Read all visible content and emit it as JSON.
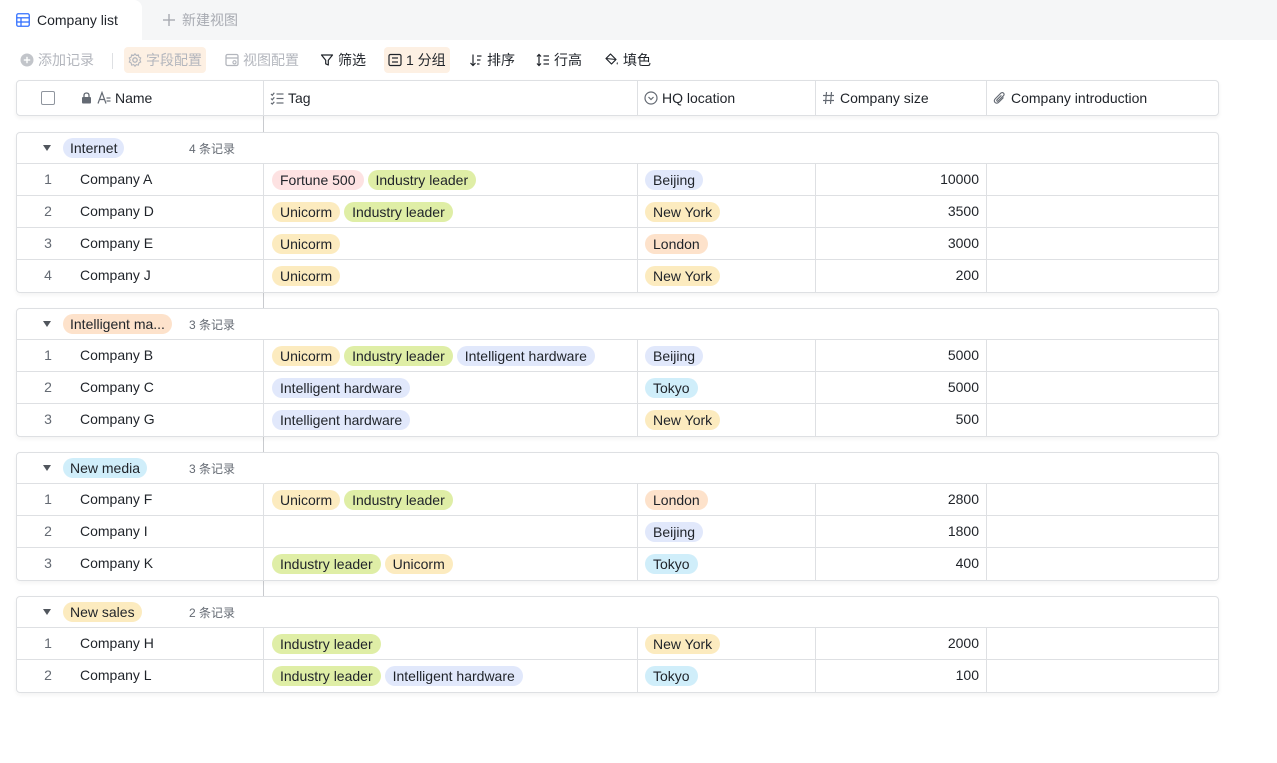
{
  "tabs": {
    "active_label": "Company list",
    "new_label": "新建视图"
  },
  "toolbar": {
    "add_record": "添加记录",
    "field_config": "字段配置",
    "view_config": "视图配置",
    "filter": "筛选",
    "group": "1 分组",
    "sort": "排序",
    "row_height": "行高",
    "fill_color": "填色"
  },
  "columns": {
    "name": "Name",
    "tag": "Tag",
    "hq": "HQ location",
    "size": "Company size",
    "intro": "Company introduction"
  },
  "colors": {
    "Fortune 500": "#fde2e2",
    "Industry leader": "#dfeea6",
    "Unicorm": "#fcebbf",
    "Intelligent hardware": "#e1e8fb",
    "Beijing": "#e1e8fb",
    "New York": "#fcebbf",
    "London": "#fde2cb",
    "Tokyo": "#d0eefa",
    "group_internet": "#e1e8fb",
    "group_intelligent": "#fde2cb",
    "group_newmedia": "#d0eefa",
    "group_newsales": "#fcebbf"
  },
  "groups": [
    {
      "name": "Internet",
      "count": "4 条记录",
      "rows": [
        {
          "num": "1",
          "name": "Company A",
          "tags": [
            "Fortune 500",
            "Industry leader"
          ],
          "hq": "Beijing",
          "size": "10000"
        },
        {
          "num": "2",
          "name": "Company D",
          "tags": [
            "Unicorm",
            "Industry leader"
          ],
          "hq": "New York",
          "size": "3500"
        },
        {
          "num": "3",
          "name": "Company E",
          "tags": [
            "Unicorm"
          ],
          "hq": "London",
          "size": "3000"
        },
        {
          "num": "4",
          "name": "Company J",
          "tags": [
            "Unicorm"
          ],
          "hq": "New York",
          "size": "200"
        }
      ]
    },
    {
      "name": "Intelligent ma...",
      "count": "3 条记录",
      "rows": [
        {
          "num": "1",
          "name": "Company B",
          "tags": [
            "Unicorm",
            "Industry leader",
            "Intelligent hardware"
          ],
          "hq": "Beijing",
          "size": "5000"
        },
        {
          "num": "2",
          "name": "Company C",
          "tags": [
            "Intelligent hardware"
          ],
          "hq": "Tokyo",
          "size": "5000"
        },
        {
          "num": "3",
          "name": "Company G",
          "tags": [
            "Intelligent hardware"
          ],
          "hq": "New York",
          "size": "500"
        }
      ]
    },
    {
      "name": "New media",
      "count": "3 条记录",
      "rows": [
        {
          "num": "1",
          "name": "Company F",
          "tags": [
            "Unicorm",
            "Industry leader"
          ],
          "hq": "London",
          "size": "2800"
        },
        {
          "num": "2",
          "name": "Company I",
          "tags": [],
          "hq": "Beijing",
          "size": "1800"
        },
        {
          "num": "3",
          "name": "Company K",
          "tags": [
            "Industry leader",
            "Unicorm"
          ],
          "hq": "Tokyo",
          "size": "400"
        }
      ]
    },
    {
      "name": "New sales",
      "count": "2 条记录",
      "rows": [
        {
          "num": "1",
          "name": "Company H",
          "tags": [
            "Industry leader"
          ],
          "hq": "New York",
          "size": "2000"
        },
        {
          "num": "2",
          "name": "Company L",
          "tags": [
            "Industry leader",
            "Intelligent hardware"
          ],
          "hq": "Tokyo",
          "size": "100"
        }
      ]
    }
  ]
}
